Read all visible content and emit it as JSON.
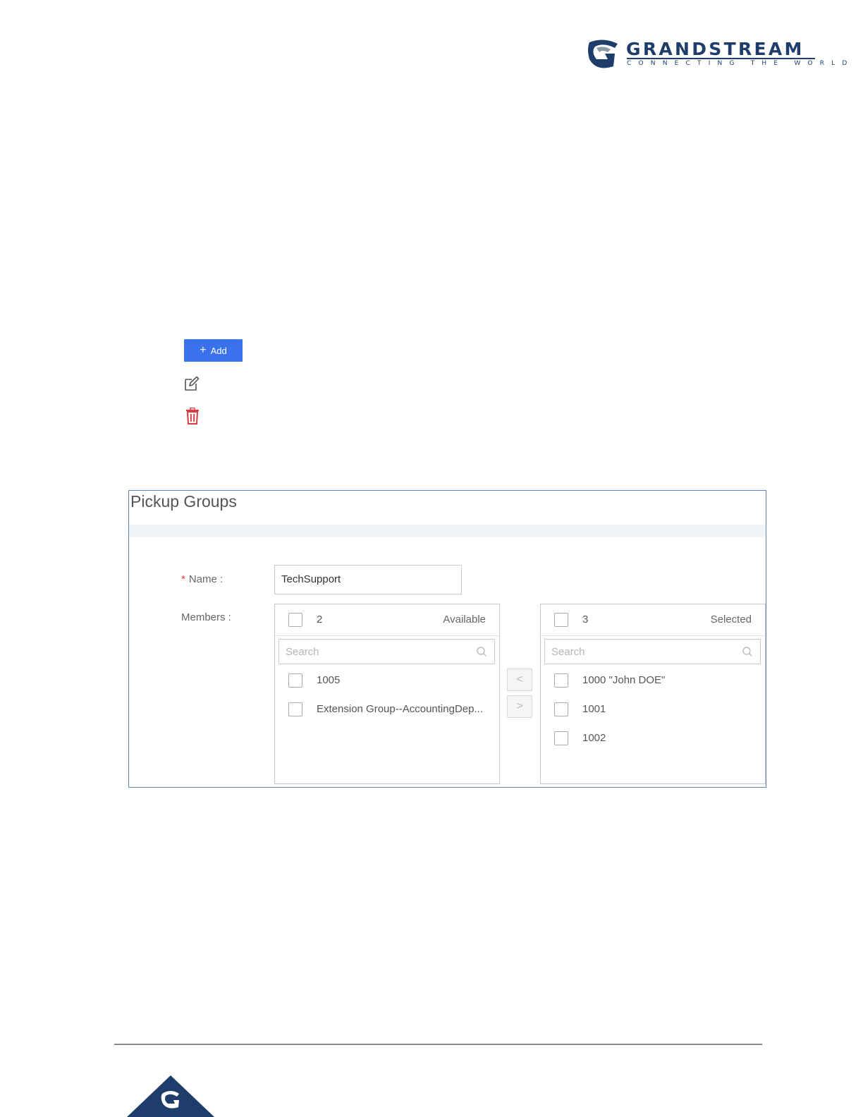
{
  "header": {
    "brand_name": "GRANDSTREAM",
    "brand_tagline": "CONNECTING THE WORLD",
    "colors": {
      "brand": "#1f3d6b",
      "accent_gray": "#8d9aa8"
    }
  },
  "actions": {
    "add_label": "Add",
    "add_icon": "plus-icon",
    "edit_icon": "edit-icon",
    "delete_icon": "trash-icon",
    "colors": {
      "add_button": "#3a72ee",
      "delete": "#e0393e"
    }
  },
  "dialog": {
    "title": "Pickup Groups",
    "name_label": "Name :",
    "name_value": "TechSupport",
    "members_label": "Members :",
    "available": {
      "count": "2",
      "status": "Available",
      "search_placeholder": "Search",
      "items": [
        {
          "label": "1005"
        },
        {
          "label": "Extension Group--AccountingDep..."
        }
      ]
    },
    "selected": {
      "count": "3",
      "status": "Selected",
      "search_placeholder": "Search",
      "items": [
        {
          "label": "1000 \"John DOE\""
        },
        {
          "label": "1001"
        },
        {
          "label": "1002"
        }
      ]
    },
    "move_left_label": "<",
    "move_right_label": ">"
  }
}
